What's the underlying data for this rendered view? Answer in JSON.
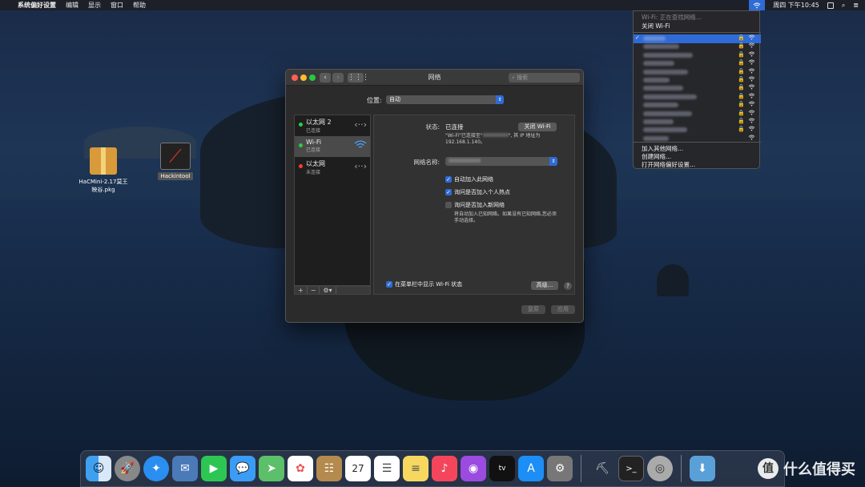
{
  "menubar": {
    "app_name": "系统偏好设置",
    "menus": [
      "编辑",
      "显示",
      "窗口",
      "帮助"
    ],
    "clock": "周四 下午10:45"
  },
  "desktop": {
    "pkg_label_line1": "HaCMini-2.17莫王",
    "pkg_label_line2": "映谷.pkg",
    "hackintool_label": "Hackintool"
  },
  "window": {
    "title": "网络",
    "search_placeholder": "搜索",
    "location_label": "位置:",
    "location_value": "自动",
    "services": [
      {
        "name": "以太网 2",
        "status": "已连接",
        "color": "#2ecc40"
      },
      {
        "name": "Wi-Fi",
        "status": "已连接",
        "color": "#2ecc40"
      },
      {
        "name": "以太网",
        "status": "未连接",
        "color": "#ff3b30"
      }
    ],
    "status_label": "状态:",
    "status_value": "已连接",
    "wifi_off_button": "关闭 Wi-Fi",
    "status_desc_line1_a": "\"Wi-Fi\"已连接至\"",
    "status_desc_line1_b": "\", 其 IP 地址为",
    "status_desc_line2": "192.168.1.140。",
    "network_name_label": "网络名称:",
    "auto_join_label": "自动加入此网络",
    "ask_hotspot_label": "询问是否加入个人热点",
    "ask_new_label": "询问是否加入新网络",
    "ask_new_desc_line1": "将自动加入已知网络。如果没有已知网络,您必须",
    "ask_new_desc_line2": "手动选择。",
    "show_in_menubar_label": "在菜单栏中显示 Wi-Fi 状态",
    "advanced_button": "高级...",
    "help": "?",
    "revert_button": "复原",
    "apply_button": "应用",
    "tools": [
      "+",
      "−",
      "⚙▾"
    ]
  },
  "wifi_menu": {
    "status": "Wi-Fi: 正在查找网络...",
    "turn_off": "关闭 Wi-Fi",
    "network_count": 13,
    "join_other": "加入其他网络...",
    "create_network": "创建网络...",
    "open_prefs": "打开网络偏好设置..."
  },
  "watermark": "什么值得买"
}
